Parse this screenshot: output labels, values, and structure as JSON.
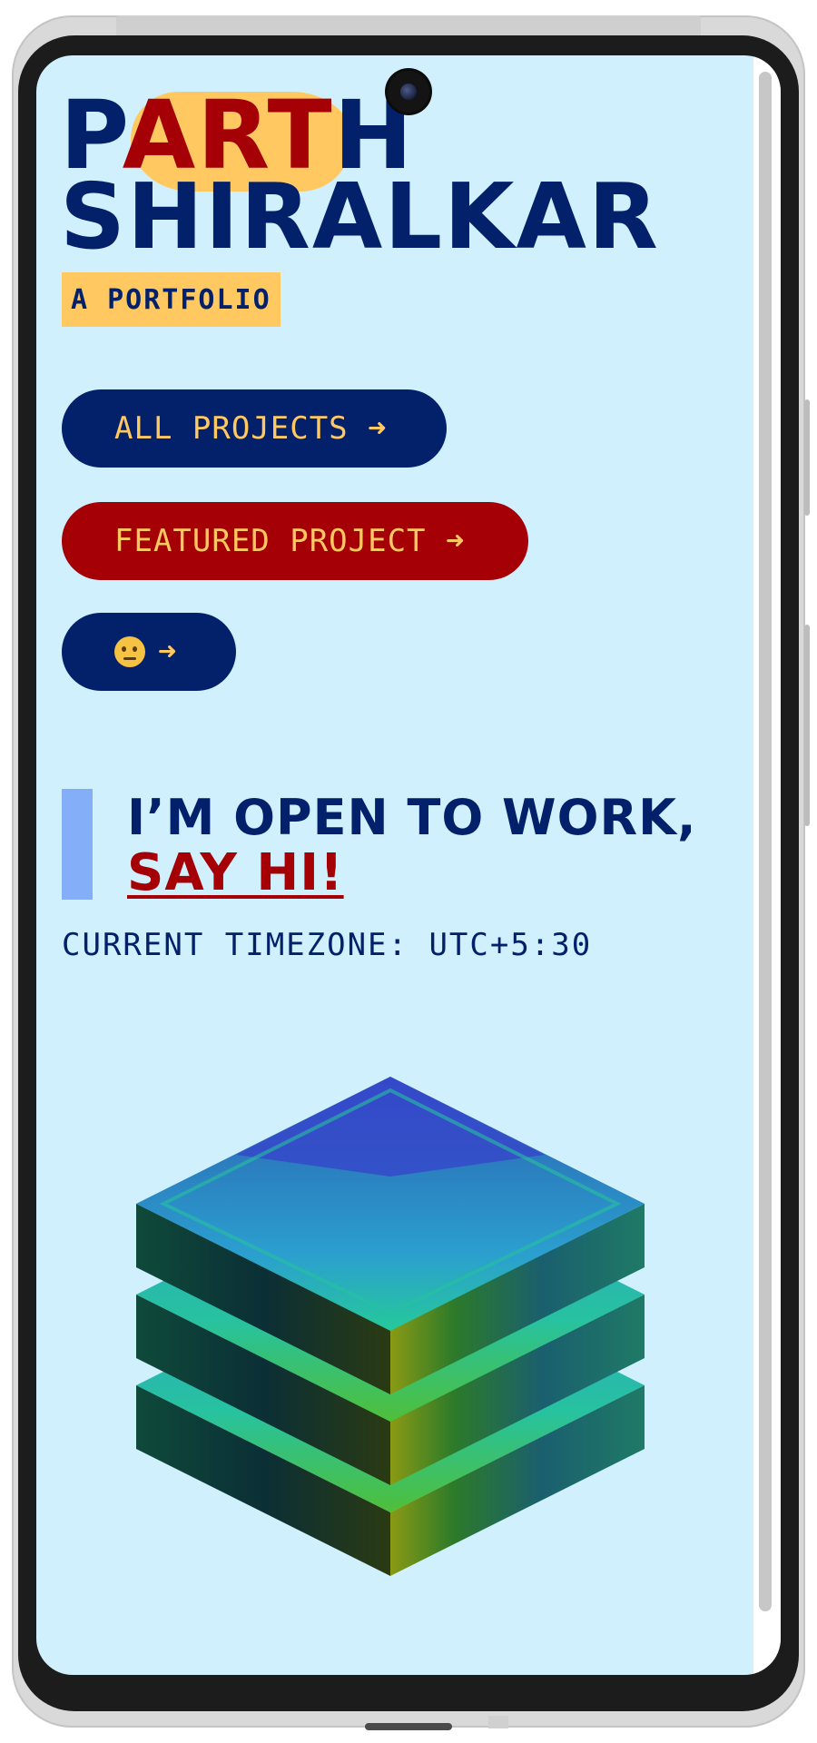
{
  "header": {
    "name_line1_prefix": "P",
    "name_line1_highlight": "ART",
    "name_line1_suffix": "H",
    "name_line2": "SHIRALKAR",
    "tagline": "A PORTFOLIO"
  },
  "actions": {
    "all_projects": "ALL PROJECTS ➜",
    "featured_project": "FEATURED PROJECT ➜",
    "about_arrow": "➜"
  },
  "contact": {
    "open_to_work": "I’M OPEN TO WORK,",
    "say_hi": "SAY HI!",
    "timezone": "CURRENT TIMEZONE: UTC+5:30"
  },
  "colors": {
    "background": "#cff0fc",
    "navy": "#03216b",
    "red": "#a40006",
    "yellow": "#ffc860",
    "accent_blue": "#85aef8"
  },
  "icons": {
    "about_button_icon": "raised-eyebrow-emoji"
  }
}
